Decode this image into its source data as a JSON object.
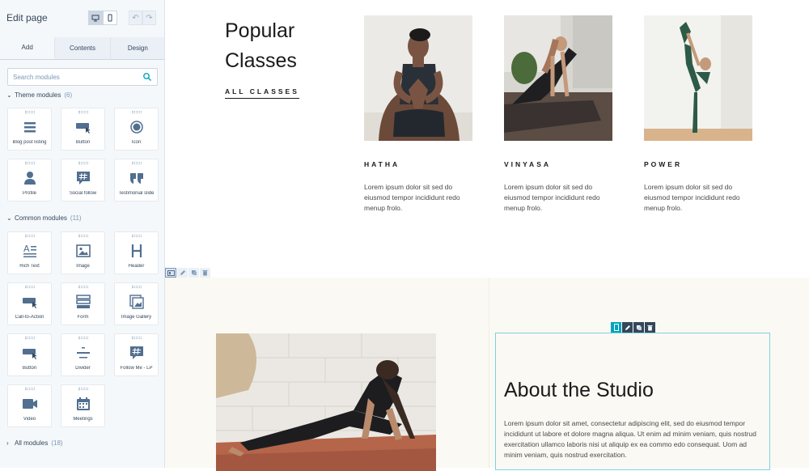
{
  "editor": {
    "title": "Edit page",
    "tabs": [
      "Add",
      "Contents",
      "Design"
    ],
    "active_tab": "Add",
    "search": {
      "placeholder": "Search modules"
    },
    "sections": {
      "theme": {
        "label": "Theme modules",
        "count": "(6)"
      },
      "common": {
        "label": "Common modules",
        "count": "(11)"
      },
      "all": {
        "label": "All modules",
        "count": "(18)"
      }
    },
    "theme_modules": [
      "Blog post listing",
      "Button",
      "Icon",
      "Profile",
      "Social follow",
      "Testimonial slide"
    ],
    "common_modules": [
      "Rich Text",
      "Image",
      "Header",
      "Call-to-Action",
      "Form",
      "Image Gallery",
      "Button",
      "Divider",
      "Follow Me - LP",
      "Video",
      "Meetings"
    ]
  },
  "page": {
    "popular": {
      "title_line1": "Popular",
      "title_line2": "Classes",
      "link": "ALL CLASSES"
    },
    "classes": [
      {
        "name": "HATHA",
        "desc": "Lorem ipsum dolor sit sed do eiusmod tempor incididunt redo menup frolo."
      },
      {
        "name": "VINYASA",
        "desc": "Lorem ipsum dolor sit sed do eiusmod tempor incididunt redo menup frolo."
      },
      {
        "name": "POWER",
        "desc": "Lorem ipsum dolor sit sed do eiusmod tempor incididunt redo menup frolo."
      }
    ],
    "about": {
      "title": "About the Studio",
      "text": "Lorem ipsum dolor sit amet, consectetur adipiscing elit, sed do eiusmod tempor incididunt ut labore et dolore magna aliqua. Ut enim ad minim veniam, quis nostrud exercitation ullamco laboris nisi ut aliquip ex ea commo edo consequat. Uom ad minim veniam, quis nostrud exercitation."
    }
  },
  "colors": {
    "accent": "#00a4bd",
    "sidebar_bg": "#f5f8fa",
    "section_bg": "#fbf9f3",
    "text_dark": "#1a1a1a"
  }
}
